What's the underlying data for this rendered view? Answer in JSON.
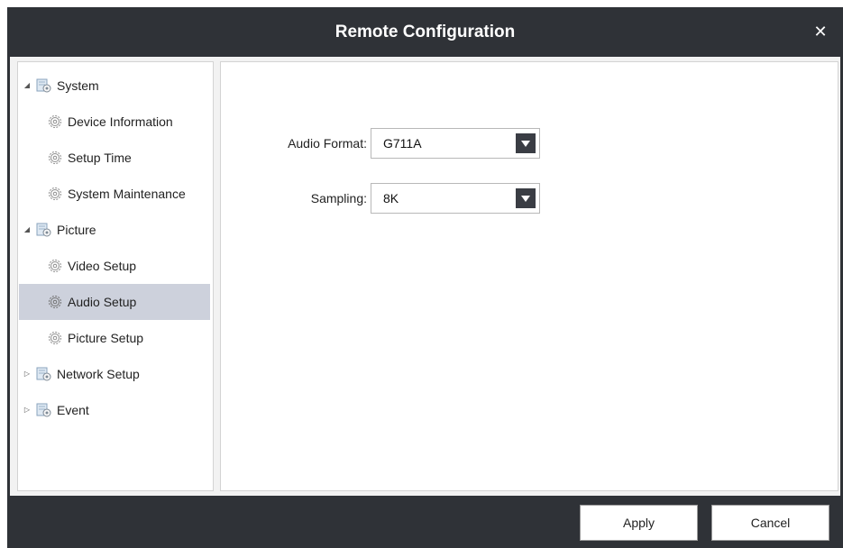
{
  "window": {
    "title": "Remote Configuration",
    "close_icon": "close-icon"
  },
  "sidebar": {
    "items": [
      {
        "label": "System",
        "type": "group",
        "expanded": true,
        "icon": "settings-folder-icon"
      },
      {
        "label": "Device Information",
        "type": "leaf",
        "icon": "gear-icon"
      },
      {
        "label": "Setup Time",
        "type": "leaf",
        "icon": "gear-icon"
      },
      {
        "label": "System Maintenance",
        "type": "leaf",
        "icon": "gear-icon"
      },
      {
        "label": "Picture",
        "type": "group",
        "expanded": true,
        "icon": "settings-folder-icon"
      },
      {
        "label": "Video Setup",
        "type": "leaf",
        "icon": "gear-icon"
      },
      {
        "label": "Audio Setup",
        "type": "leaf",
        "icon": "gear-icon",
        "selected": true
      },
      {
        "label": "Picture Setup",
        "type": "leaf",
        "icon": "gear-icon"
      },
      {
        "label": "Network Setup",
        "type": "group",
        "expanded": false,
        "icon": "settings-folder-icon"
      },
      {
        "label": "Event",
        "type": "group",
        "expanded": false,
        "icon": "settings-folder-icon"
      }
    ]
  },
  "form": {
    "audio_format": {
      "label": "Audio Format:",
      "value": "G711A"
    },
    "sampling": {
      "label": "Sampling:",
      "value": "8K"
    }
  },
  "footer": {
    "apply_label": "Apply",
    "cancel_label": "Cancel"
  },
  "colors": {
    "titlebar": "#2f3237",
    "selection": "#cdd1dc",
    "dropdown_button": "#3a3d44"
  }
}
